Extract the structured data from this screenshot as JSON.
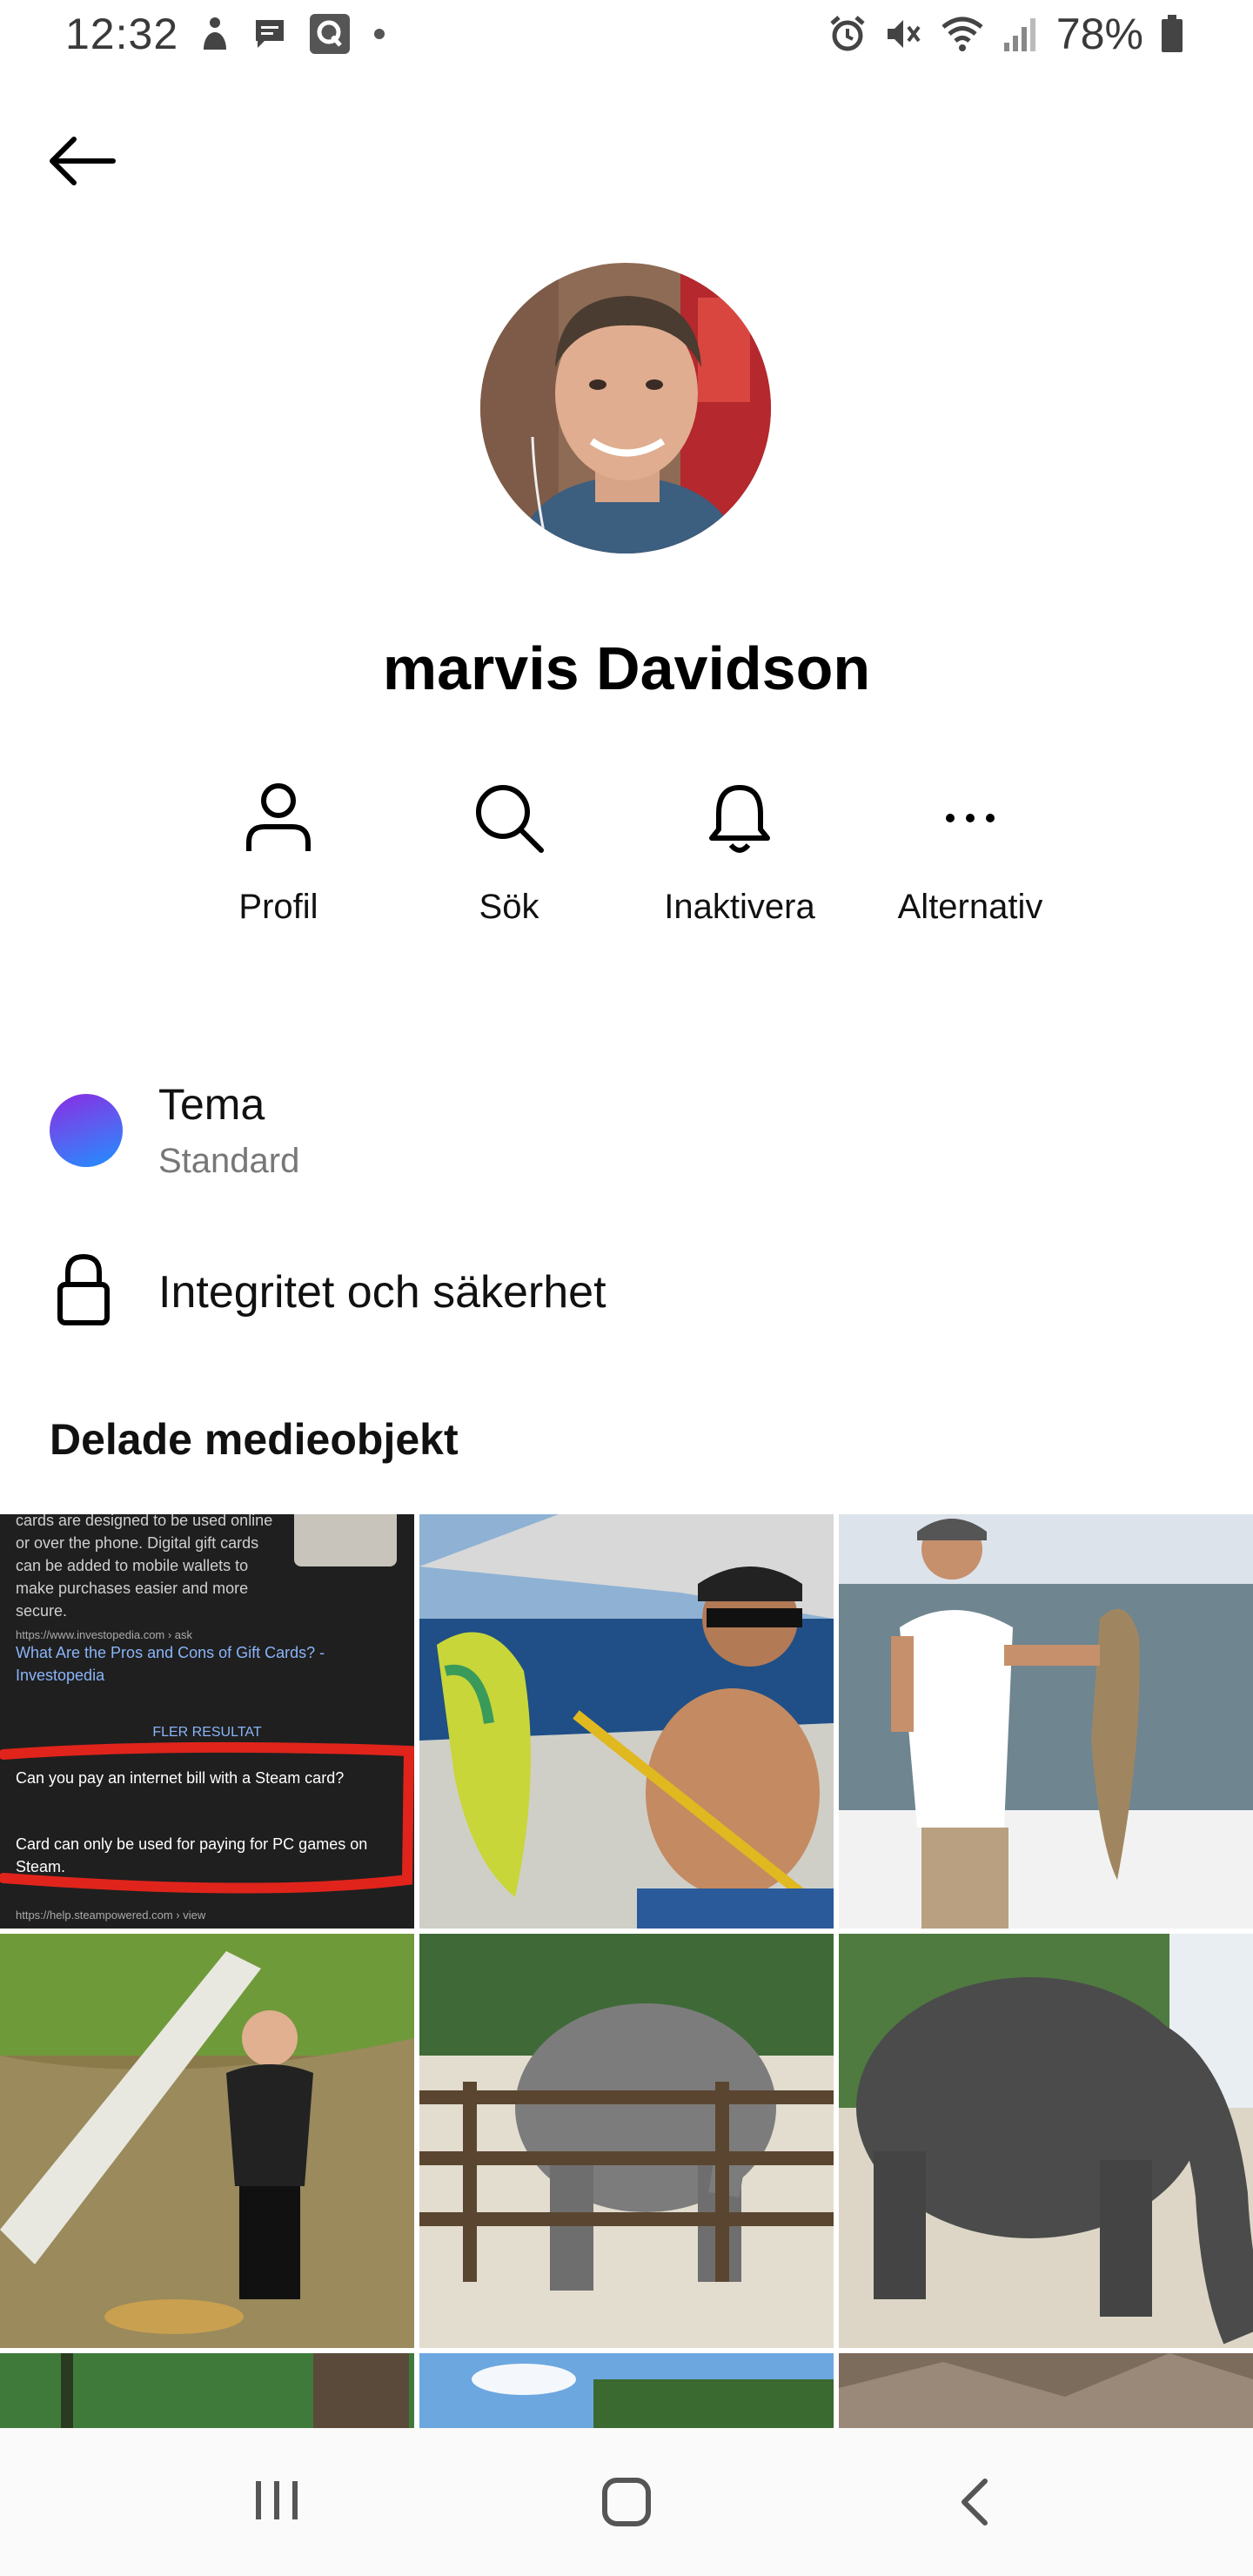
{
  "status_bar": {
    "time": "12:32",
    "battery": "78%",
    "left_icons": [
      "accessibility-icon",
      "chat-icon",
      "q-app-icon",
      "dot-icon"
    ],
    "right_icons": [
      "alarm-icon",
      "mute-icon",
      "wifi-icon",
      "signal-icon",
      "battery-icon"
    ]
  },
  "header": {
    "back_icon": "back-arrow-icon"
  },
  "profile": {
    "name": "marvis Davidson"
  },
  "actions": [
    {
      "label": "Profil",
      "icon": "person-icon"
    },
    {
      "label": "Sök",
      "icon": "search-icon"
    },
    {
      "label": "Inaktivera",
      "icon": "bell-icon"
    },
    {
      "label": "Alternativ",
      "icon": "more-icon"
    }
  ],
  "settings": {
    "theme": {
      "title": "Tema",
      "value": "Standard"
    },
    "privacy": {
      "label": "Integritet och säkerhet"
    }
  },
  "shared_media": {
    "title": "Delade medieobjekt",
    "screenshot_tile": {
      "text1": "cards are designed to be used online or over the phone. Digital gift cards can be added to mobile wallets to make purchases easier and more secure.",
      "url1": "https://www.investopedia.com › ask",
      "link": "What Are the Pros and Cons of Gift Cards? - Investopedia",
      "more": "FLER RESULTAT",
      "question": "Can you pay an internet bill with a Steam card?",
      "answer": "Card can only be used for paying for PC games on Steam.",
      "url2": "https://help.steampowered.com › view"
    }
  },
  "nav": {
    "recents_icon": "recents-icon",
    "home_icon": "home-icon",
    "back_icon": "nav-back-icon"
  }
}
